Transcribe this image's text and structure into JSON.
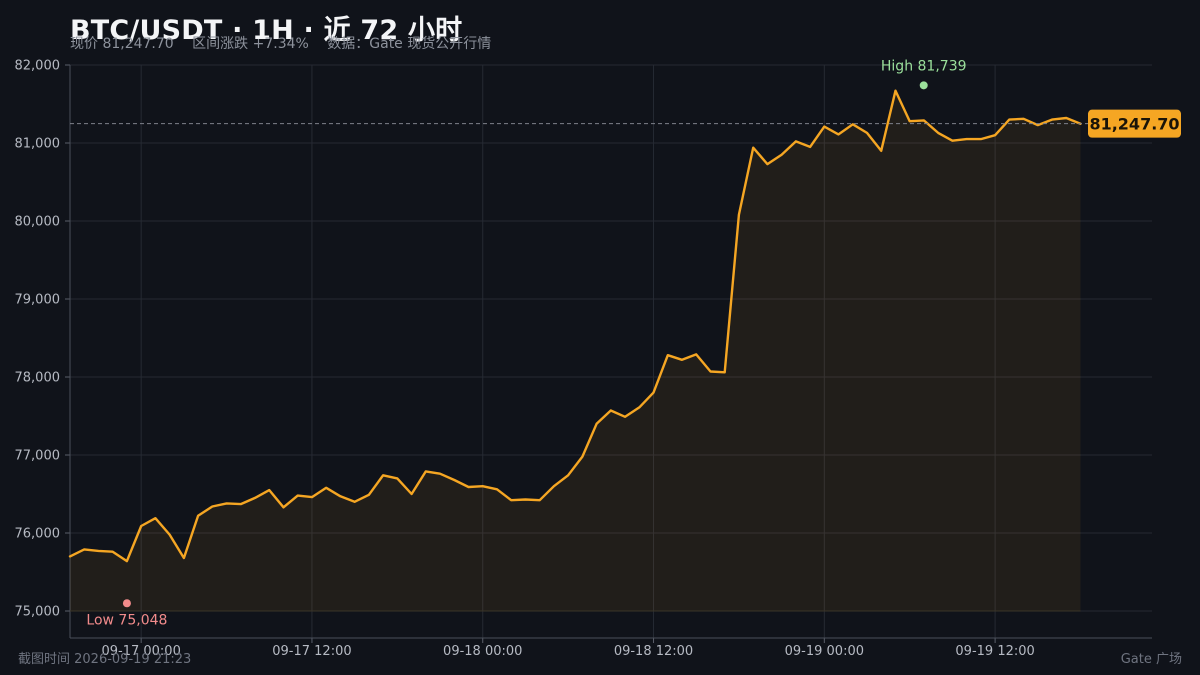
{
  "title": "BTC/USDT · 1H · 近 72 小时",
  "subtitle": {
    "price": "现价 81,247.70",
    "change": "区间涨跌 +7.34%",
    "source": "数据：Gate 现货公开行情"
  },
  "footer": {
    "timestamp": "截图时间 2026-09-19 21:23",
    "brand": "Gate 广场"
  },
  "colors": {
    "line": "#f5a623",
    "high": "#9be09b",
    "low": "#f28b8b",
    "price_tag_bg": "#f5a623"
  },
  "chart_data": {
    "type": "line",
    "title": "BTC/USDT · 1H · 近 72 小时",
    "x_start": "2026-09-16 19:00",
    "x_step_hours": 1,
    "ylim": [
      75000,
      82000
    ],
    "yticks": [
      75000,
      76000,
      77000,
      78000,
      79000,
      80000,
      81000,
      82000
    ],
    "ytick_labels": [
      "75,000",
      "76,000",
      "77,000",
      "78,000",
      "79,000",
      "80,000",
      "81,000",
      "82,000"
    ],
    "xtick_labels": [
      "09-17 00:00",
      "09-17 12:00",
      "09-18 00:00",
      "09-18 12:00",
      "09-19 00:00",
      "09-19 12:00"
    ],
    "xtick_index": [
      5,
      17,
      29,
      41,
      53,
      65
    ],
    "grid": true,
    "series": [
      {
        "values": [
          75700,
          75790,
          75770,
          75760,
          75640,
          76090,
          76190,
          75980,
          75680,
          76220,
          76340,
          76380,
          76370,
          76450,
          76550,
          76330,
          76480,
          76460,
          76580,
          76470,
          76400,
          76490,
          76740,
          76700,
          76500,
          76790,
          76760,
          76680,
          76590,
          76600,
          76560,
          76420,
          76430,
          76420,
          76600,
          76740,
          76980,
          77400,
          77570,
          77490,
          77610,
          77800,
          78280,
          78220,
          78290,
          78070,
          78060,
          80080,
          80940,
          80730,
          80850,
          81020,
          80950,
          81210,
          81110,
          81240,
          81130,
          80900,
          81670,
          81280,
          81290,
          81130,
          81030,
          81050,
          81050,
          81100,
          81300,
          81310,
          81230,
          81300,
          81320,
          81247.7
        ]
      }
    ],
    "current_price": 81247.7,
    "current_price_label": "81,247.70",
    "high_label": "High 81,739",
    "high_value": 81739,
    "high_index": 59,
    "low_label": "Low 75,048",
    "low_value": 75048,
    "low_index": 4
  }
}
